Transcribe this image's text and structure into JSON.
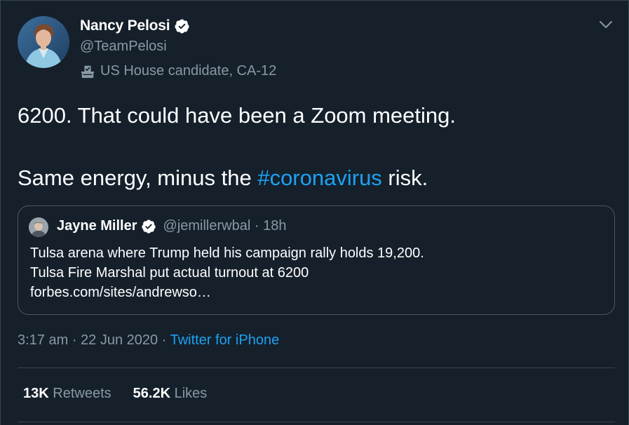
{
  "author": {
    "name": "Nancy Pelosi",
    "handle": "@TeamPelosi",
    "label": "US House candidate, CA-12"
  },
  "tweet": {
    "line1": "6200. That could have been a Zoom meeting.",
    "line2_before": "Same energy, minus the ",
    "hashtag": "#coronavirus",
    "line2_after": " risk."
  },
  "quoted": {
    "name": "Jayne Miller",
    "handle": "@jemillerwbal",
    "separator": "·",
    "time": "18h",
    "lines": [
      "Tulsa arena where Trump held his campaign rally holds 19,200.",
      "Tulsa Fire Marshal put actual turnout at 6200",
      "forbes.com/sites/andrewso…"
    ]
  },
  "meta": {
    "time": "3:17 am",
    "sep1": " · ",
    "date": "22 Jun 2020",
    "sep2": " · ",
    "source": "Twitter for iPhone"
  },
  "stats": {
    "retweets_count": "13K",
    "retweets_label": "Retweets",
    "likes_count": "56.2K",
    "likes_label": "Likes"
  },
  "icons": {
    "verified": "verified-badge-icon",
    "ballot": "ballot-box-icon",
    "more": "chevron-down-icon"
  },
  "colors": {
    "background": "#15202b",
    "accent": "#1da1f2",
    "secondary_text": "#8899a6",
    "border": "#38444d"
  }
}
